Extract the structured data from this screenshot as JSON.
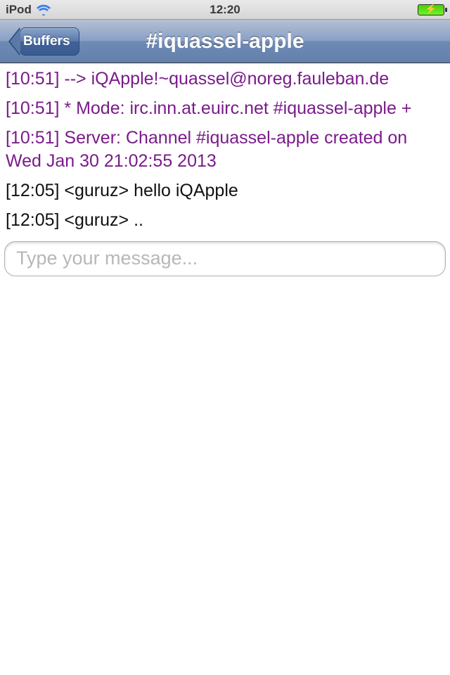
{
  "status_bar": {
    "carrier": "iPod",
    "time": "12:20"
  },
  "nav": {
    "back_label": "Buffers",
    "title": "#iquassel-apple"
  },
  "messages": [
    {
      "kind": "system",
      "text": "[10:51] --> iQApple!~quassel@noreg.fauleban.de"
    },
    {
      "kind": "system",
      "text": "[10:51] * Mode: irc.inn.at.euirc.net #iquassel-apple +"
    },
    {
      "kind": "system",
      "text": "[10:51] Server: Channel #iquassel-apple created on Wed Jan 30 21:02:55 2013"
    },
    {
      "kind": "normal",
      "text": "[12:05] <guruz> hello iQApple"
    },
    {
      "kind": "normal",
      "text": "[12:05] <guruz> .."
    }
  ],
  "input": {
    "placeholder": "Type your message...",
    "value": ""
  },
  "colors": {
    "system_message": "#7a1b8b",
    "nav_gradient_top": "#b5c0d3",
    "nav_gradient_bottom": "#6380ac"
  }
}
